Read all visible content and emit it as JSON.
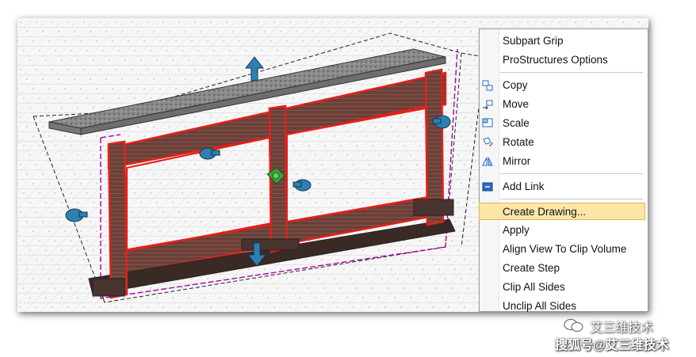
{
  "context_menu": {
    "items": [
      {
        "label": "Subpart Grip",
        "icon": "none"
      },
      {
        "label": "ProStructures Options",
        "icon": "none"
      },
      {
        "label": "Copy",
        "icon": "copy-icon"
      },
      {
        "label": "Move",
        "icon": "move-icon"
      },
      {
        "label": "Scale",
        "icon": "scale-icon"
      },
      {
        "label": "Rotate",
        "icon": "rotate-icon"
      },
      {
        "label": "Mirror",
        "icon": "mirror-icon"
      },
      {
        "label": "Add Link",
        "icon": "link-icon"
      },
      {
        "label": "Create Drawing...",
        "icon": "none",
        "highlighted": true
      },
      {
        "label": "Apply",
        "icon": "none"
      },
      {
        "label": "Align View To Clip Volume",
        "icon": "none"
      },
      {
        "label": "Create Step",
        "icon": "none"
      },
      {
        "label": "Clip All Sides",
        "icon": "none"
      },
      {
        "label": "Unclip All Sides",
        "icon": "none"
      }
    ]
  },
  "watermark": {
    "line1": "艾三维技术",
    "line2": "搜狐号@艾三维技术",
    "icon": "wechat-icon"
  },
  "colors": {
    "highlight_fill": "#fbe6a8",
    "highlight_border": "#e2b54b",
    "structure_red": "#e3201b",
    "concrete_fill": "#6e4a42",
    "handle_blue": "#2f7fb0",
    "handle_green": "#3aa53a",
    "clip_magenta": "#b000b0"
  }
}
